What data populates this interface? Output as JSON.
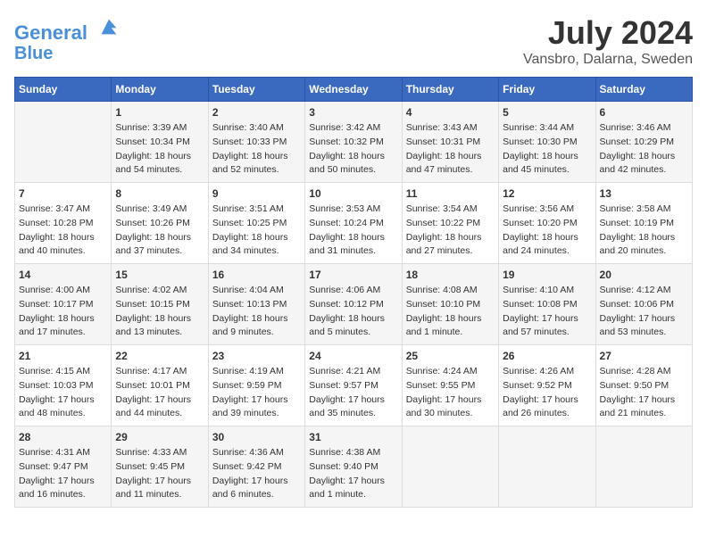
{
  "logo": {
    "line1": "General",
    "line2": "Blue"
  },
  "title": "July 2024",
  "location": "Vansbro, Dalarna, Sweden",
  "headers": [
    "Sunday",
    "Monday",
    "Tuesday",
    "Wednesday",
    "Thursday",
    "Friday",
    "Saturday"
  ],
  "weeks": [
    [
      {
        "day": "",
        "sunrise": "",
        "sunset": "",
        "daylight": ""
      },
      {
        "day": "1",
        "sunrise": "Sunrise: 3:39 AM",
        "sunset": "Sunset: 10:34 PM",
        "daylight": "Daylight: 18 hours and 54 minutes."
      },
      {
        "day": "2",
        "sunrise": "Sunrise: 3:40 AM",
        "sunset": "Sunset: 10:33 PM",
        "daylight": "Daylight: 18 hours and 52 minutes."
      },
      {
        "day": "3",
        "sunrise": "Sunrise: 3:42 AM",
        "sunset": "Sunset: 10:32 PM",
        "daylight": "Daylight: 18 hours and 50 minutes."
      },
      {
        "day": "4",
        "sunrise": "Sunrise: 3:43 AM",
        "sunset": "Sunset: 10:31 PM",
        "daylight": "Daylight: 18 hours and 47 minutes."
      },
      {
        "day": "5",
        "sunrise": "Sunrise: 3:44 AM",
        "sunset": "Sunset: 10:30 PM",
        "daylight": "Daylight: 18 hours and 45 minutes."
      },
      {
        "day": "6",
        "sunrise": "Sunrise: 3:46 AM",
        "sunset": "Sunset: 10:29 PM",
        "daylight": "Daylight: 18 hours and 42 minutes."
      }
    ],
    [
      {
        "day": "7",
        "sunrise": "Sunrise: 3:47 AM",
        "sunset": "Sunset: 10:28 PM",
        "daylight": "Daylight: 18 hours and 40 minutes."
      },
      {
        "day": "8",
        "sunrise": "Sunrise: 3:49 AM",
        "sunset": "Sunset: 10:26 PM",
        "daylight": "Daylight: 18 hours and 37 minutes."
      },
      {
        "day": "9",
        "sunrise": "Sunrise: 3:51 AM",
        "sunset": "Sunset: 10:25 PM",
        "daylight": "Daylight: 18 hours and 34 minutes."
      },
      {
        "day": "10",
        "sunrise": "Sunrise: 3:53 AM",
        "sunset": "Sunset: 10:24 PM",
        "daylight": "Daylight: 18 hours and 31 minutes."
      },
      {
        "day": "11",
        "sunrise": "Sunrise: 3:54 AM",
        "sunset": "Sunset: 10:22 PM",
        "daylight": "Daylight: 18 hours and 27 minutes."
      },
      {
        "day": "12",
        "sunrise": "Sunrise: 3:56 AM",
        "sunset": "Sunset: 10:20 PM",
        "daylight": "Daylight: 18 hours and 24 minutes."
      },
      {
        "day": "13",
        "sunrise": "Sunrise: 3:58 AM",
        "sunset": "Sunset: 10:19 PM",
        "daylight": "Daylight: 18 hours and 20 minutes."
      }
    ],
    [
      {
        "day": "14",
        "sunrise": "Sunrise: 4:00 AM",
        "sunset": "Sunset: 10:17 PM",
        "daylight": "Daylight: 18 hours and 17 minutes."
      },
      {
        "day": "15",
        "sunrise": "Sunrise: 4:02 AM",
        "sunset": "Sunset: 10:15 PM",
        "daylight": "Daylight: 18 hours and 13 minutes."
      },
      {
        "day": "16",
        "sunrise": "Sunrise: 4:04 AM",
        "sunset": "Sunset: 10:13 PM",
        "daylight": "Daylight: 18 hours and 9 minutes."
      },
      {
        "day": "17",
        "sunrise": "Sunrise: 4:06 AM",
        "sunset": "Sunset: 10:12 PM",
        "daylight": "Daylight: 18 hours and 5 minutes."
      },
      {
        "day": "18",
        "sunrise": "Sunrise: 4:08 AM",
        "sunset": "Sunset: 10:10 PM",
        "daylight": "Daylight: 18 hours and 1 minute."
      },
      {
        "day": "19",
        "sunrise": "Sunrise: 4:10 AM",
        "sunset": "Sunset: 10:08 PM",
        "daylight": "Daylight: 17 hours and 57 minutes."
      },
      {
        "day": "20",
        "sunrise": "Sunrise: 4:12 AM",
        "sunset": "Sunset: 10:06 PM",
        "daylight": "Daylight: 17 hours and 53 minutes."
      }
    ],
    [
      {
        "day": "21",
        "sunrise": "Sunrise: 4:15 AM",
        "sunset": "Sunset: 10:03 PM",
        "daylight": "Daylight: 17 hours and 48 minutes."
      },
      {
        "day": "22",
        "sunrise": "Sunrise: 4:17 AM",
        "sunset": "Sunset: 10:01 PM",
        "daylight": "Daylight: 17 hours and 44 minutes."
      },
      {
        "day": "23",
        "sunrise": "Sunrise: 4:19 AM",
        "sunset": "Sunset: 9:59 PM",
        "daylight": "Daylight: 17 hours and 39 minutes."
      },
      {
        "day": "24",
        "sunrise": "Sunrise: 4:21 AM",
        "sunset": "Sunset: 9:57 PM",
        "daylight": "Daylight: 17 hours and 35 minutes."
      },
      {
        "day": "25",
        "sunrise": "Sunrise: 4:24 AM",
        "sunset": "Sunset: 9:55 PM",
        "daylight": "Daylight: 17 hours and 30 minutes."
      },
      {
        "day": "26",
        "sunrise": "Sunrise: 4:26 AM",
        "sunset": "Sunset: 9:52 PM",
        "daylight": "Daylight: 17 hours and 26 minutes."
      },
      {
        "day": "27",
        "sunrise": "Sunrise: 4:28 AM",
        "sunset": "Sunset: 9:50 PM",
        "daylight": "Daylight: 17 hours and 21 minutes."
      }
    ],
    [
      {
        "day": "28",
        "sunrise": "Sunrise: 4:31 AM",
        "sunset": "Sunset: 9:47 PM",
        "daylight": "Daylight: 17 hours and 16 minutes."
      },
      {
        "day": "29",
        "sunrise": "Sunrise: 4:33 AM",
        "sunset": "Sunset: 9:45 PM",
        "daylight": "Daylight: 17 hours and 11 minutes."
      },
      {
        "day": "30",
        "sunrise": "Sunrise: 4:36 AM",
        "sunset": "Sunset: 9:42 PM",
        "daylight": "Daylight: 17 hours and 6 minutes."
      },
      {
        "day": "31",
        "sunrise": "Sunrise: 4:38 AM",
        "sunset": "Sunset: 9:40 PM",
        "daylight": "Daylight: 17 hours and 1 minute."
      },
      {
        "day": "",
        "sunrise": "",
        "sunset": "",
        "daylight": ""
      },
      {
        "day": "",
        "sunrise": "",
        "sunset": "",
        "daylight": ""
      },
      {
        "day": "",
        "sunrise": "",
        "sunset": "",
        "daylight": ""
      }
    ]
  ]
}
